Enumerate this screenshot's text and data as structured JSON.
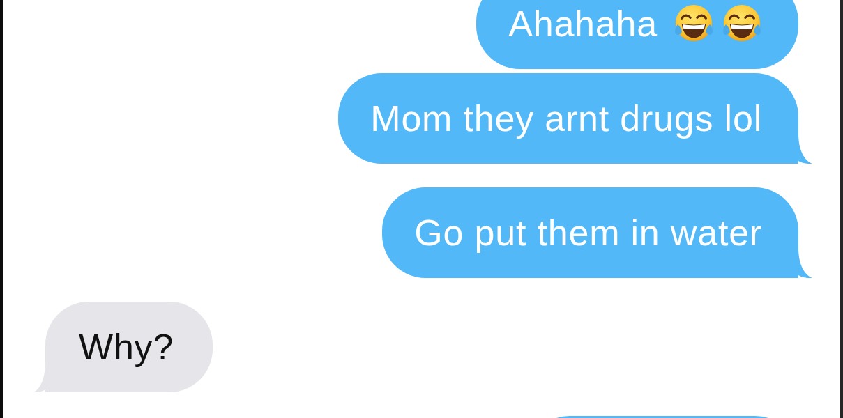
{
  "messages": [
    {
      "kind": "sent",
      "text": "Ahahaha",
      "emoji": [
        {
          "kind": "laughing"
        },
        {
          "kind": "laughing"
        }
      ],
      "tail": false
    },
    {
      "kind": "sent",
      "text": "Mom they arnt drugs lol",
      "tail": true
    },
    {
      "kind": "sent",
      "text": "Go put them in water",
      "tail": true
    },
    {
      "kind": "received",
      "text": "Why?",
      "tail": true
    },
    {
      "kind": "sent"
    }
  ]
}
